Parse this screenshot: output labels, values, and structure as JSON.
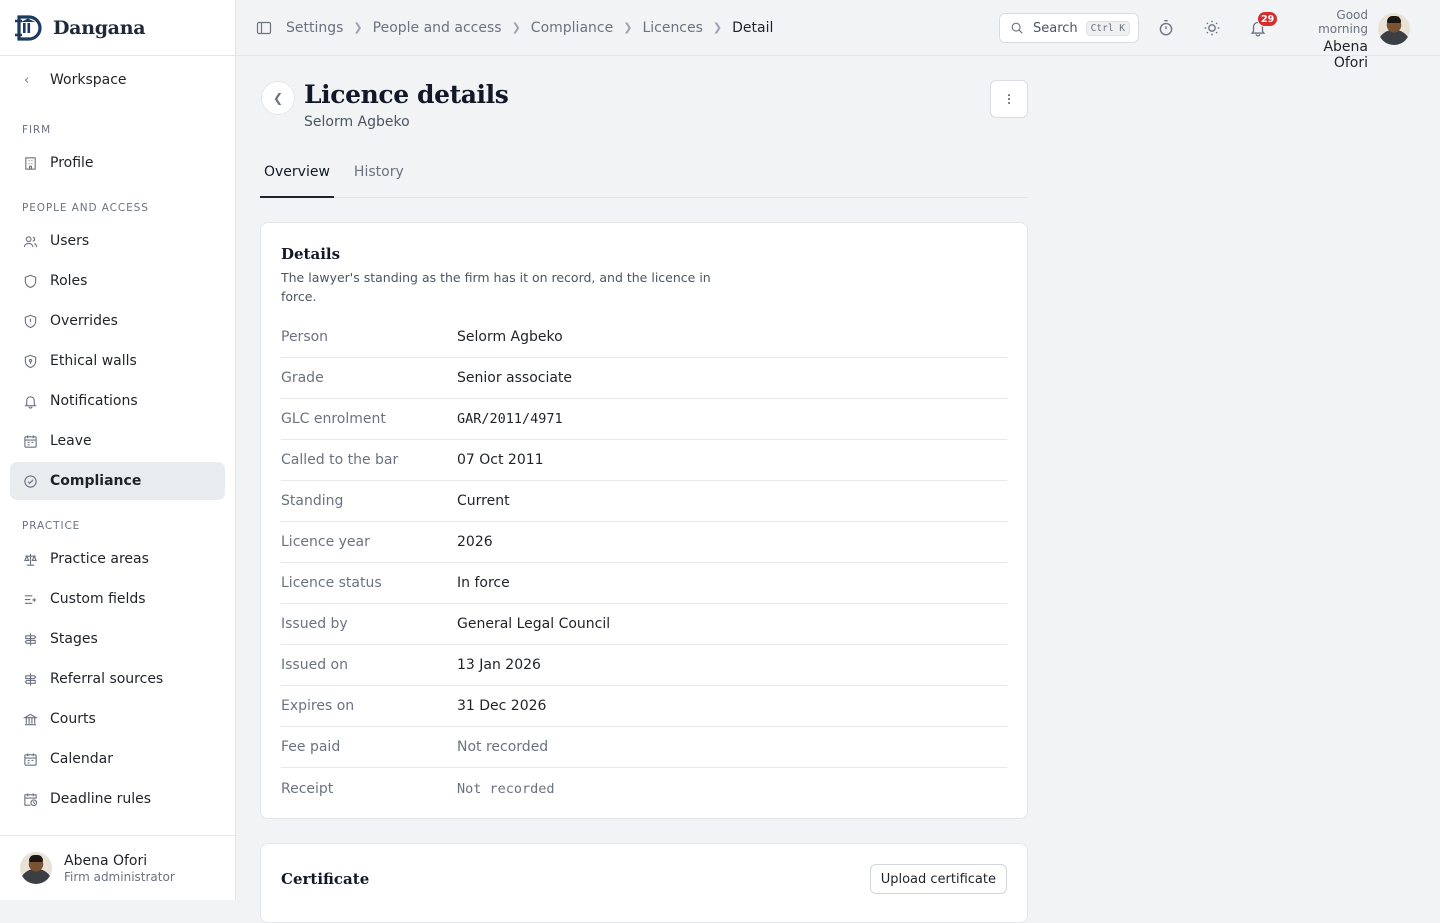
{
  "brand": {
    "name": "Dangana"
  },
  "sidebar": {
    "back_label": "Workspace",
    "sections": [
      {
        "label": "Firm",
        "items": [
          {
            "label": "Profile",
            "icon": "building-icon"
          }
        ]
      },
      {
        "label": "People and access",
        "items": [
          {
            "label": "Users",
            "icon": "users-icon"
          },
          {
            "label": "Roles",
            "icon": "shield-icon"
          },
          {
            "label": "Overrides",
            "icon": "shield-alert-icon"
          },
          {
            "label": "Ethical walls",
            "icon": "shield-lock-icon"
          },
          {
            "label": "Notifications",
            "icon": "bell-icon"
          },
          {
            "label": "Leave",
            "icon": "calendar-icon"
          },
          {
            "label": "Compliance",
            "icon": "check-circle-icon",
            "active": true
          }
        ]
      },
      {
        "label": "Practice",
        "items": [
          {
            "label": "Practice areas",
            "icon": "scales-icon"
          },
          {
            "label": "Custom fields",
            "icon": "list-plus-icon"
          },
          {
            "label": "Stages",
            "icon": "signpost-icon"
          },
          {
            "label": "Referral sources",
            "icon": "signpost-icon"
          },
          {
            "label": "Courts",
            "icon": "landmark-icon"
          },
          {
            "label": "Calendar",
            "icon": "calendar-icon"
          },
          {
            "label": "Deadline rules",
            "icon": "calendar-clock-icon"
          }
        ]
      }
    ],
    "user": {
      "name": "Abena Ofori",
      "role": "Firm administrator"
    }
  },
  "topbar": {
    "breadcrumbs": [
      "Settings",
      "People and access",
      "Compliance",
      "Licences",
      "Detail"
    ],
    "search": {
      "label": "Search",
      "shortcut": "Ctrl K"
    },
    "notifications_count": "29",
    "greeting": "Good morning",
    "user_name": "Abena Ofori"
  },
  "page": {
    "title": "Licence details",
    "subtitle": "Selorm Agbeko",
    "tabs": [
      "Overview",
      "History"
    ],
    "active_tab": "Overview"
  },
  "details": {
    "title": "Details",
    "description": "The lawyer's standing as the firm has it on record, and the licence in force.",
    "rows": [
      {
        "label": "Person",
        "value": "Selorm Agbeko"
      },
      {
        "label": "Grade",
        "value": "Senior associate"
      },
      {
        "label": "GLC enrolment",
        "value": "GAR/2011/4971",
        "mono": true
      },
      {
        "label": "Called to the bar",
        "value": "07 Oct 2011"
      },
      {
        "label": "Standing",
        "value": "Current"
      },
      {
        "label": "Licence year",
        "value": "2026"
      },
      {
        "label": "Licence status",
        "value": "In force"
      },
      {
        "label": "Issued by",
        "value": "General Legal Council"
      },
      {
        "label": "Issued on",
        "value": "13 Jan 2026"
      },
      {
        "label": "Expires on",
        "value": "31 Dec 2026"
      },
      {
        "label": "Fee paid",
        "value": "Not recorded",
        "muted": true
      },
      {
        "label": "Receipt",
        "value": "Not recorded",
        "muted": true,
        "mono": true
      }
    ]
  },
  "certificate": {
    "title": "Certificate",
    "upload_label": "Upload certificate"
  },
  "colors": {
    "accent": "#1f2328",
    "badge": "#d62d2d",
    "background": "#f1f3f5",
    "active_nav": "#e9ecef"
  }
}
